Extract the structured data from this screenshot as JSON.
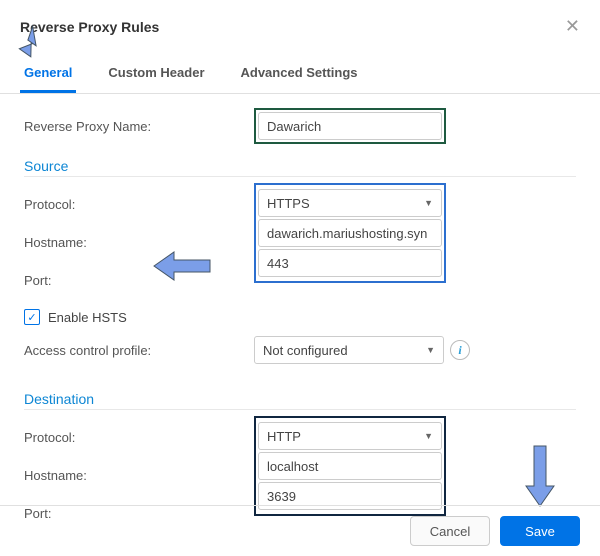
{
  "dialog": {
    "title": "Reverse Proxy Rules"
  },
  "tabs": {
    "general": "General",
    "custom_header": "Custom Header",
    "advanced": "Advanced Settings"
  },
  "fields": {
    "reverse_proxy_name_label": "Reverse Proxy Name:",
    "reverse_proxy_name_value": "Dawarich",
    "source_title": "Source",
    "protocol_label": "Protocol:",
    "hostname_label": "Hostname:",
    "port_label": "Port:",
    "source_protocol": "HTTPS",
    "source_hostname": "dawarich.mariushosting.syn",
    "source_port": "443",
    "enable_hsts_label": "Enable HSTS",
    "enable_hsts_checked": true,
    "access_control_label": "Access control profile:",
    "access_control_value": "Not configured",
    "destination_title": "Destination",
    "dest_protocol": "HTTP",
    "dest_hostname": "localhost",
    "dest_port": "3639"
  },
  "buttons": {
    "cancel": "Cancel",
    "save": "Save"
  },
  "colors": {
    "accent": "#0073e6",
    "arrow": "#7b9ee8"
  }
}
